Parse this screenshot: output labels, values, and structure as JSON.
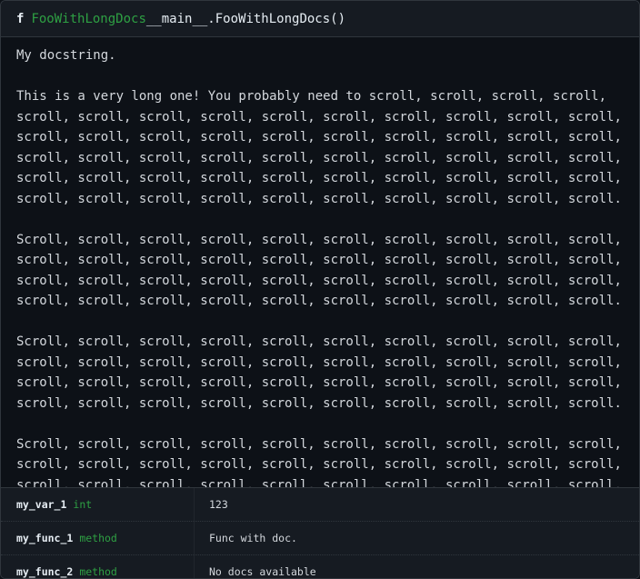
{
  "header": {
    "kind": "f",
    "name": "FooWithLongDocs",
    "signature": "__main__.FooWithLongDocs()"
  },
  "docstring_lines": [
    "My docstring.",
    "",
    "This is a very long one! You probably need to scroll, scroll, scroll, scroll,",
    "scroll, scroll, scroll, scroll, scroll, scroll, scroll, scroll, scroll, scroll,",
    "scroll, scroll, scroll, scroll, scroll, scroll, scroll, scroll, scroll, scroll,",
    "scroll, scroll, scroll, scroll, scroll, scroll, scroll, scroll, scroll, scroll,",
    "scroll, scroll, scroll, scroll, scroll, scroll, scroll, scroll, scroll, scroll,",
    "scroll, scroll, scroll, scroll, scroll, scroll, scroll, scroll, scroll, scroll.",
    "",
    "Scroll, scroll, scroll, scroll, scroll, scroll, scroll, scroll, scroll, scroll,",
    "scroll, scroll, scroll, scroll, scroll, scroll, scroll, scroll, scroll, scroll,",
    "scroll, scroll, scroll, scroll, scroll, scroll, scroll, scroll, scroll, scroll,",
    "scroll, scroll, scroll, scroll, scroll, scroll, scroll, scroll, scroll, scroll.",
    "",
    "Scroll, scroll, scroll, scroll, scroll, scroll, scroll, scroll, scroll, scroll,",
    "scroll, scroll, scroll, scroll, scroll, scroll, scroll, scroll, scroll, scroll,",
    "scroll, scroll, scroll, scroll, scroll, scroll, scroll, scroll, scroll, scroll,",
    "scroll, scroll, scroll, scroll, scroll, scroll, scroll, scroll, scroll, scroll.",
    "",
    "Scroll, scroll, scroll, scroll, scroll, scroll, scroll, scroll, scroll, scroll,",
    "scroll, scroll, scroll, scroll, scroll, scroll, scroll, scroll, scroll, scroll,",
    "scroll, scroll, scroll, scroll, scroll, scroll, scroll, scroll, scroll, scroll,"
  ],
  "members": [
    {
      "name": "my_var_1",
      "type": "int",
      "doc": "123"
    },
    {
      "name": "my_func_1",
      "type": "method",
      "doc": "Func with doc."
    },
    {
      "name": "my_func_2",
      "type": "method",
      "doc": "No docs available"
    }
  ]
}
